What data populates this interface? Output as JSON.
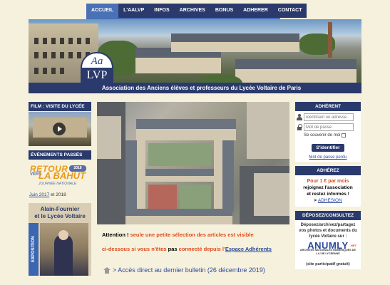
{
  "nav": {
    "items": [
      "ACCUEIL",
      "L'AALVP",
      "INFOS",
      "ARCHIVES",
      "BONUS",
      "ADHERER",
      "CONTACT"
    ],
    "active": "ACCUEIL"
  },
  "banner": {
    "logo_top": "Aa",
    "logo_bottom": "LVP",
    "association": "Association des Anciens élèves et professeurs du Lycée Voltaire de Paris"
  },
  "left": {
    "film_heading": "FILM : VISITE DU LYCÉE",
    "events_heading": "ÉVÉNEMENTS PASSÉS",
    "retour_line1": "RETOUR",
    "retour_line2": "VERS",
    "retour_line3": "LA BAHUT",
    "retour_badge": "2018",
    "retour_sub": "JOURNÉE NATIONALE",
    "link_june": "Juin 2017",
    "link_and": " et 2018",
    "af_title1": "Alain-Fournier",
    "af_title2": "et le Lycée Voltaire",
    "af_expo": "EXPOSITION"
  },
  "main": {
    "attention": "Attention !",
    "notice_red1": " seule une petite sélection des articles est  visible",
    "notice_red2": "ci-dessous si vous n'êtes",
    "notice_pas": " pas ",
    "notice_red3": "connecté depuis l'",
    "notice_link": "Espace  Adhérents",
    "direct_link": "> Accès direct au dernier bulletin (26 décembre 2019)"
  },
  "right": {
    "adherent_heading": "ADHÉRENT",
    "login_placeholder": "Identifiant ou adresse",
    "password_placeholder": "Mot de passe",
    "remember_label": "Se souvenir de moi",
    "login_button": "S'identifier",
    "lost_password": "Mot de passe perdu",
    "adhere_heading": "ADHÉREZ",
    "adhere_price": "Pour 1 € par mois",
    "adhere_line2": "rejoignez l'association",
    "adhere_line3": "et restez informés !",
    "adhere_arrow": "> ",
    "adhere_link": "ADHESION",
    "deposez_heading": "DÉPOSEZ/CONSULTEZ",
    "deposez_text": "Déposez/archivez/partagez vos photos et documents du lycée Voltaire sur :",
    "anumly_logo": "ANUMLY",
    "anumly_net": ".NET",
    "anumly_sub": "ARCHIVES NATIONALES NUMÉRIQUES DE LA VIE LYCÉENNE",
    "free_note": "(site participatif gratuit)"
  },
  "colors": {
    "navy": "#2a3a6c",
    "nav_active": "#4a70b5",
    "background": "#f6f1dc",
    "alert_red": "#e04a1c",
    "link_blue": "#2a4a9c"
  }
}
